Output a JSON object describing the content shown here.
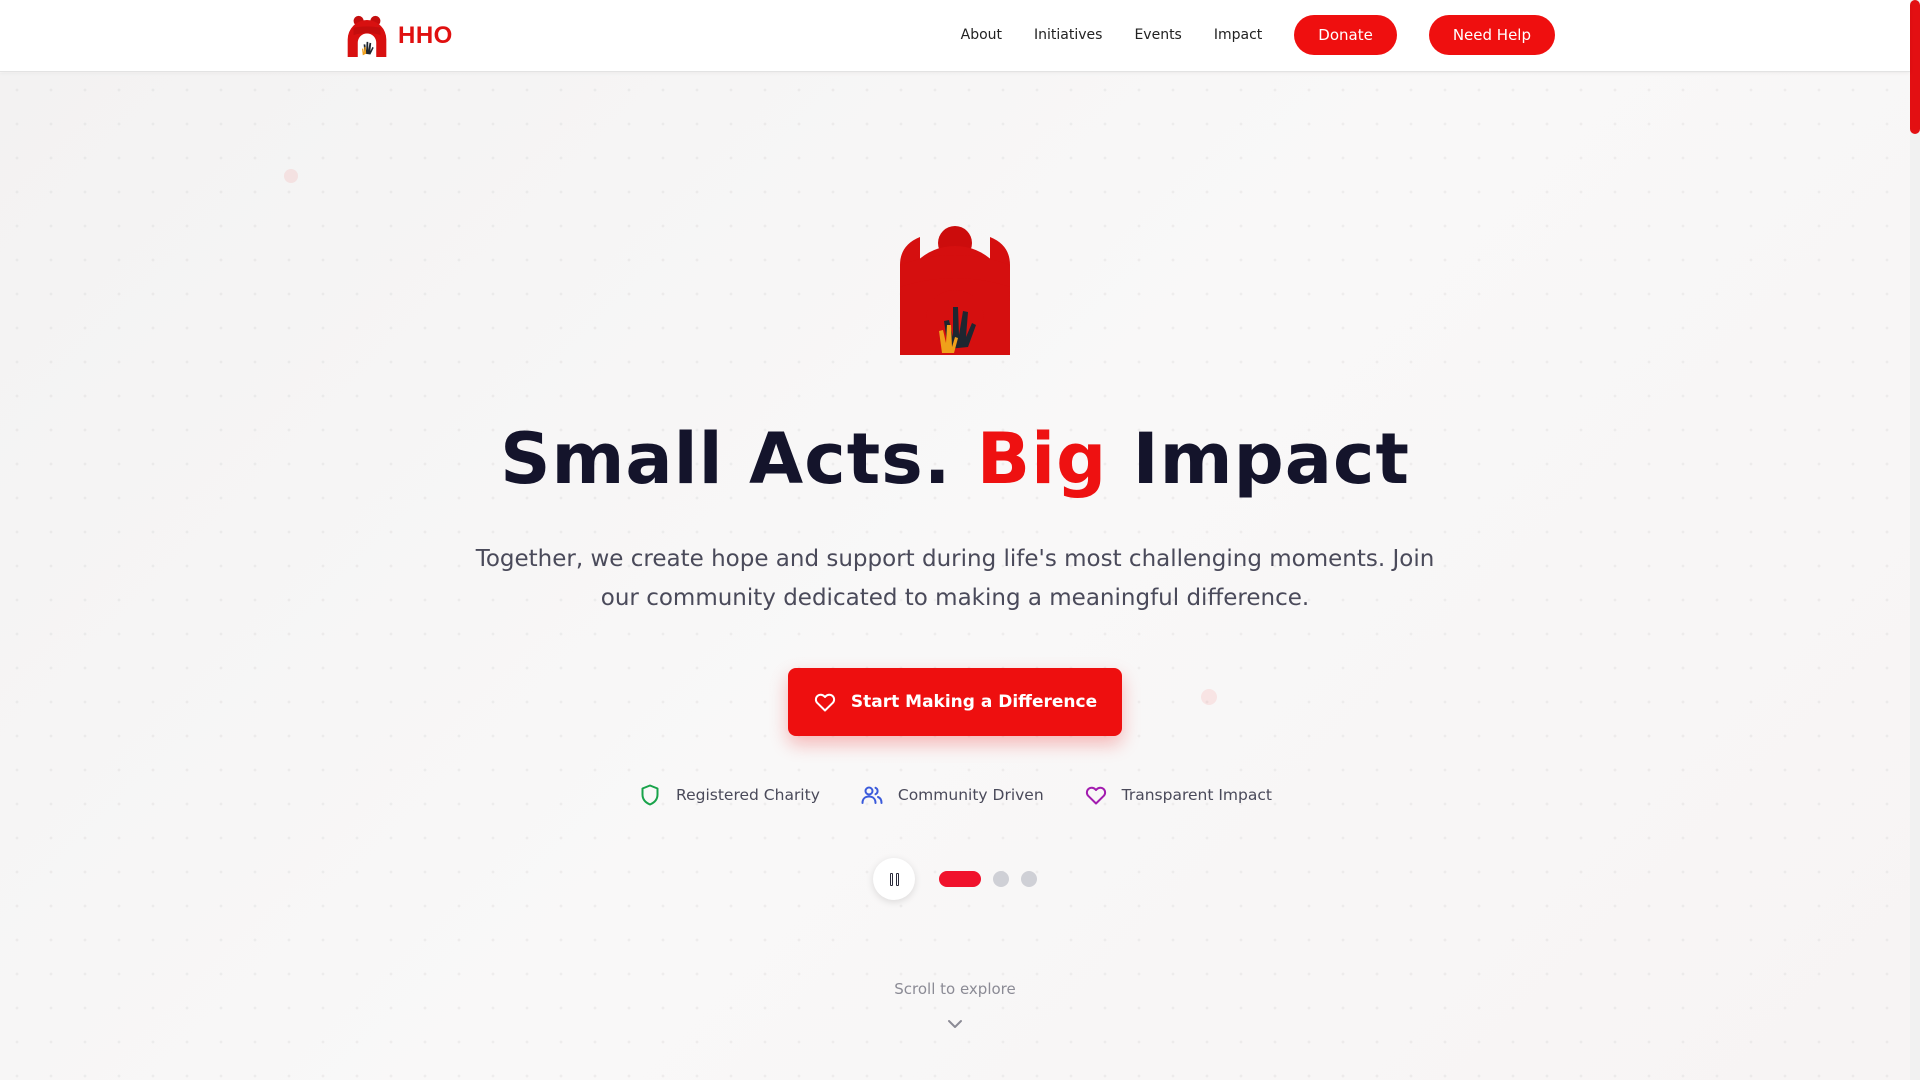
{
  "header": {
    "brand_name": "HHO",
    "nav_links": [
      "About",
      "Initiatives",
      "Events",
      "Impact"
    ],
    "donate_label": "Donate",
    "need_help_label": "Need Help"
  },
  "hero": {
    "headline_part1": "Small Acts. ",
    "headline_accent": "Big",
    "headline_part2": " Impact",
    "subtitle": "Together, we create hope and support during life's most challenging moments. Join our community dedicated to making a meaningful difference.",
    "cta_label": "Start Making a Difference",
    "features": [
      {
        "label": "Registered Charity",
        "icon": "shield-icon",
        "color": "#18a34a"
      },
      {
        "label": "Community Driven",
        "icon": "users-icon",
        "color": "#3b5bdb"
      },
      {
        "label": "Transparent Impact",
        "icon": "heart-icon",
        "color": "#a21caf"
      }
    ],
    "carousel": {
      "slide_count": 3,
      "active_index": 0
    },
    "scroll_hint": "Scroll to explore"
  },
  "colors": {
    "brand_red": "#ee0f0f",
    "headline_dark": "#14142b",
    "body_text": "#4a4a5a"
  }
}
